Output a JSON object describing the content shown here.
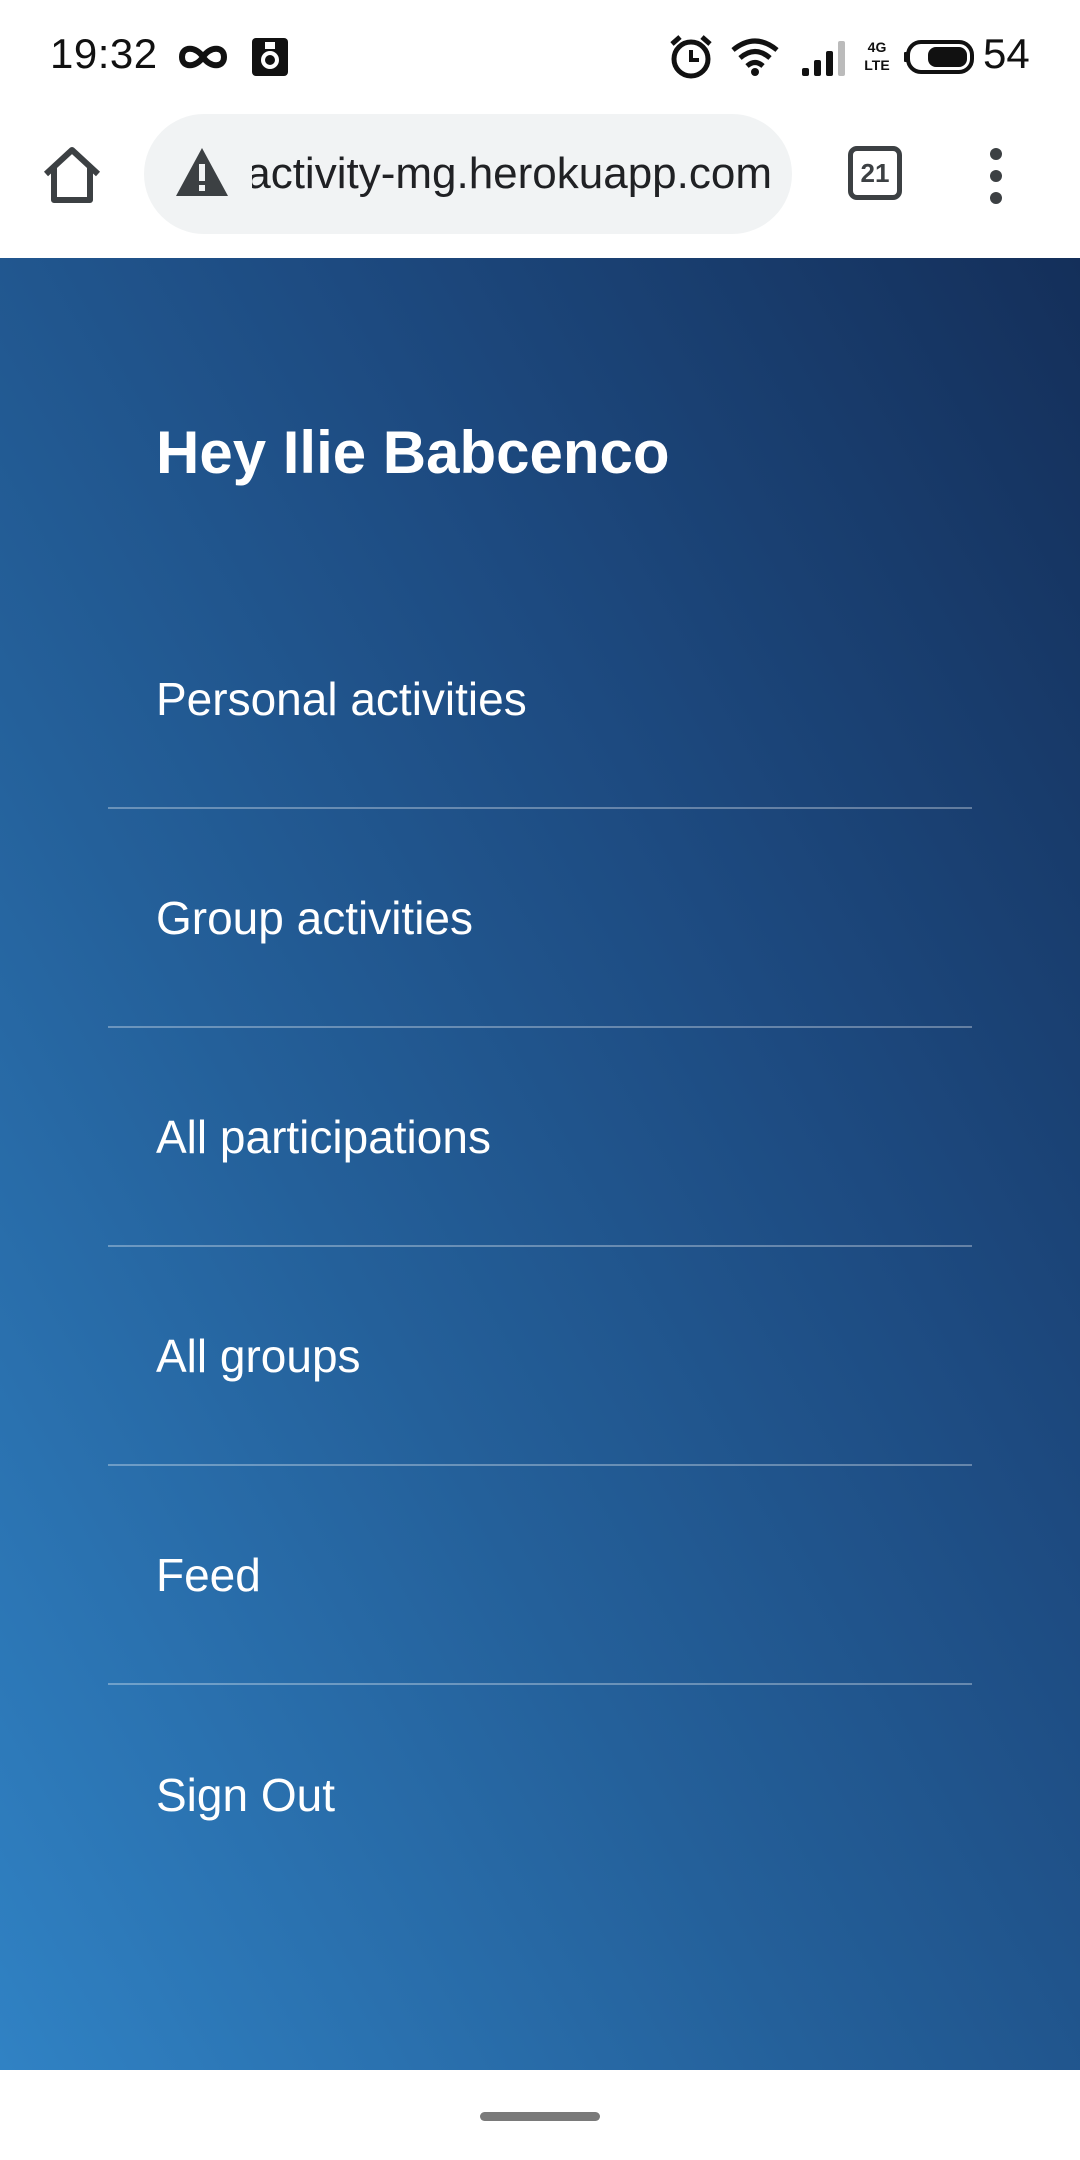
{
  "status_bar": {
    "time": "19:32",
    "battery_level": "54",
    "network_badge_top": "4G",
    "network_badge_bottom": "LTE",
    "icons": [
      "infinity-icon",
      "app-notification-icon",
      "alarm-icon",
      "wifi-icon",
      "signal-icon",
      "battery-icon"
    ]
  },
  "browser": {
    "url": "activity-mg.herokuapp.com",
    "tab_count": "21",
    "icons": [
      "home-icon",
      "not-secure-warning-icon",
      "tabs-icon",
      "more-vert-icon"
    ]
  },
  "page": {
    "greeting": "Hey Ilie Babcenco",
    "nav_items": [
      {
        "label": "Personal activities"
      },
      {
        "label": "Group activities"
      },
      {
        "label": "All participations"
      },
      {
        "label": "All groups"
      },
      {
        "label": "Feed"
      },
      {
        "label": "Sign Out"
      }
    ]
  },
  "colors": {
    "gradient_light": "#3082c4",
    "gradient_dark": "#142f5a",
    "url_bar_bg": "#f1f3f4",
    "text_on_gradient": "#ffffff"
  }
}
